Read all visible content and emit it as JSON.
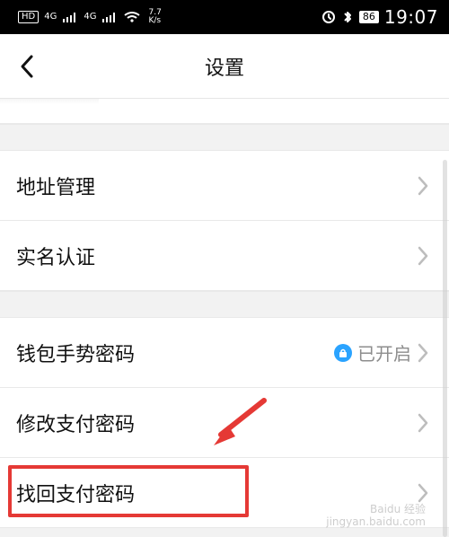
{
  "status_bar": {
    "left_badge": "HD",
    "network_1": "4G",
    "network_2": "4G",
    "speed_value": "7.7",
    "speed_unit": "K/s",
    "battery": "86",
    "time": "19:07"
  },
  "header": {
    "title": "设置"
  },
  "settings": {
    "items": [
      {
        "label": "地址管理"
      },
      {
        "label": "实名认证"
      },
      {
        "label": "钱包手势密码",
        "status": "已开启"
      },
      {
        "label": "修改支付密码"
      },
      {
        "label": "找回支付密码"
      }
    ]
  },
  "watermark": {
    "line1": "Baidu 经验",
    "line2": "jingyan.baidu.com"
  },
  "colors": {
    "highlight": "#e53935",
    "accent": "#2aa3ff"
  }
}
